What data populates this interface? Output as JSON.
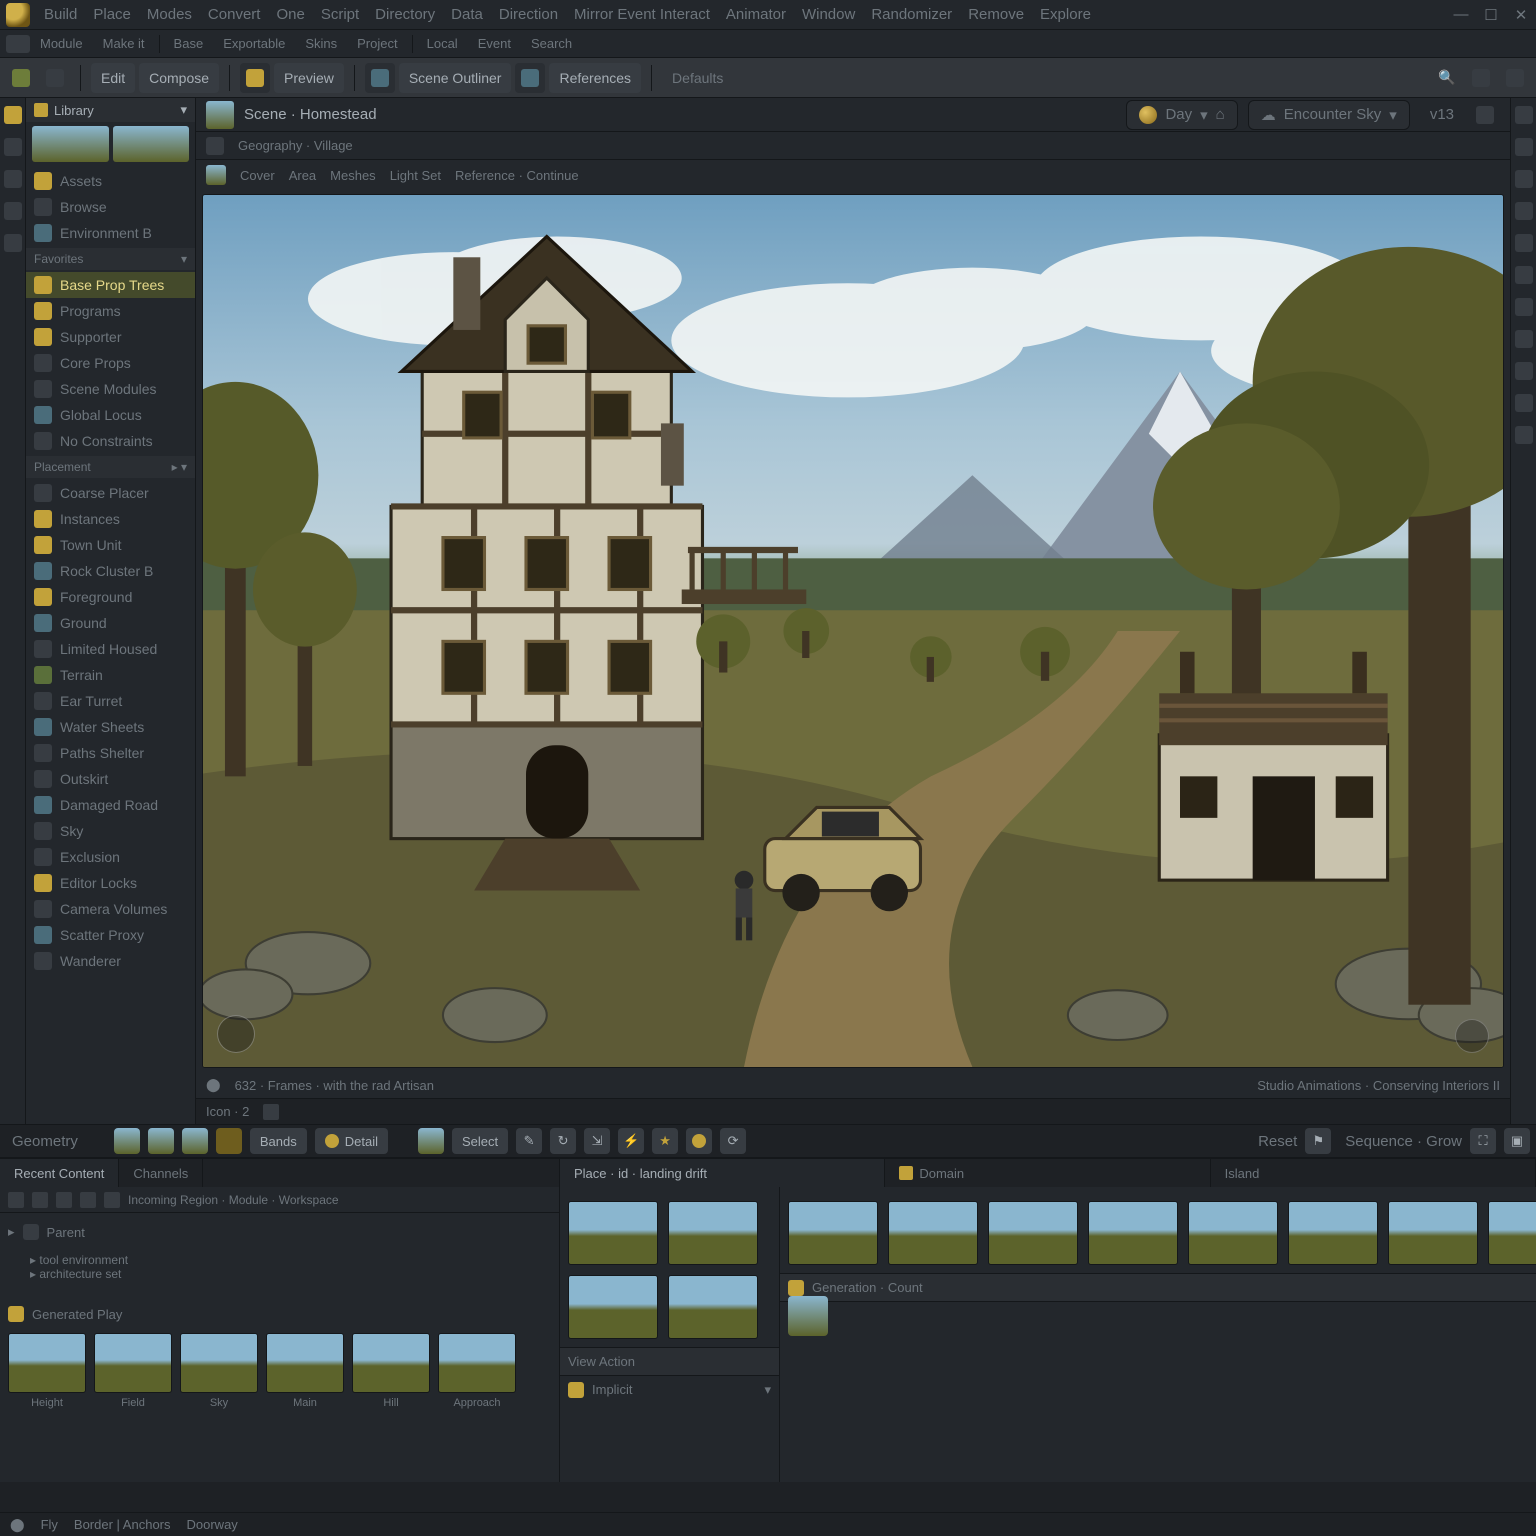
{
  "menu": [
    "Build",
    "Place",
    "Modes",
    "Convert",
    "One",
    "Script",
    "Directory",
    "Data",
    "Direction",
    "Mirror Event Interact",
    "Animator",
    "Window",
    "Randomizer",
    "Remove",
    "Explore"
  ],
  "secondary": [
    "Module",
    "Make it",
    "Base",
    "Exportable",
    "Skins",
    "Project",
    "Local",
    "Event",
    "Search"
  ],
  "toolbar": {
    "mode": "Edit",
    "tab1": "Compose",
    "tab2": "Preview",
    "tab3": "Scene Outliner",
    "tab4": "References",
    "tab5": "Defaults"
  },
  "sidebar_header": "Library",
  "sidebar_top": [
    "Assets",
    "Browse",
    "Environment B"
  ],
  "sidebar_fav": "Favorites",
  "sidebar_items1": [
    "Base Prop Trees",
    "Programs",
    "Supporter",
    "Core Props",
    "Scene Modules",
    "Global Locus",
    "No Constraints"
  ],
  "sidebar_section": "Placement",
  "sidebar_items2": [
    "Coarse Placer",
    "Instances",
    "Town Unit",
    "Rock Cluster B",
    "Foreground",
    "Ground",
    "Limited Housed",
    "Terrain",
    "Ear Turret",
    "Water Sheets",
    "Paths Shelter",
    "Outskirt",
    "Damaged Road",
    "Sky",
    "Exclusion",
    "Editor Locks",
    "Camera Volumes",
    "Scatter Proxy",
    "Wanderer"
  ],
  "doc": {
    "title": "Scene · Homestead",
    "subtitle": "Geography · Village",
    "breadcrumbs": [
      "Cover",
      "Area",
      "Meshes",
      "Light Set",
      "Reference · Continue"
    ],
    "pill1": "Day",
    "pill2": "Encounter Sky",
    "ver": "v13"
  },
  "viewport": {
    "status_left": "632 · Frames · with the rad Artisan",
    "status_right": "Studio Animations · Conserving Interiors II",
    "pos": "Icon · 2"
  },
  "lowbar": {
    "a": "Geometry",
    "b": "Bands",
    "c": "Detail",
    "d": "Select",
    "e": "Reset",
    "f": "Sequence · Grow"
  },
  "bottom_left": {
    "tab1": "Recent Content",
    "tab2": "Channels",
    "crumbs": "Incoming Region · Module · Workspace",
    "hdr1": "Parent",
    "hdr2": "Generated Play",
    "thumbs": [
      "Height",
      "Field",
      "Sky",
      "Main",
      "Hill",
      "Approach"
    ]
  },
  "bottom_right": {
    "hdr1": "Place · id · landing drift",
    "hdr2": "Domain",
    "hdr3": "Island",
    "sec1": "View Action",
    "sec1v": "Implicit",
    "sec2": "Generation · Count",
    "thumbs": [
      "",
      "",
      "",
      "",
      "",
      "",
      "",
      ""
    ]
  },
  "status": {
    "a": "Fly",
    "b": "Border | Anchors",
    "c": "Doorway"
  }
}
